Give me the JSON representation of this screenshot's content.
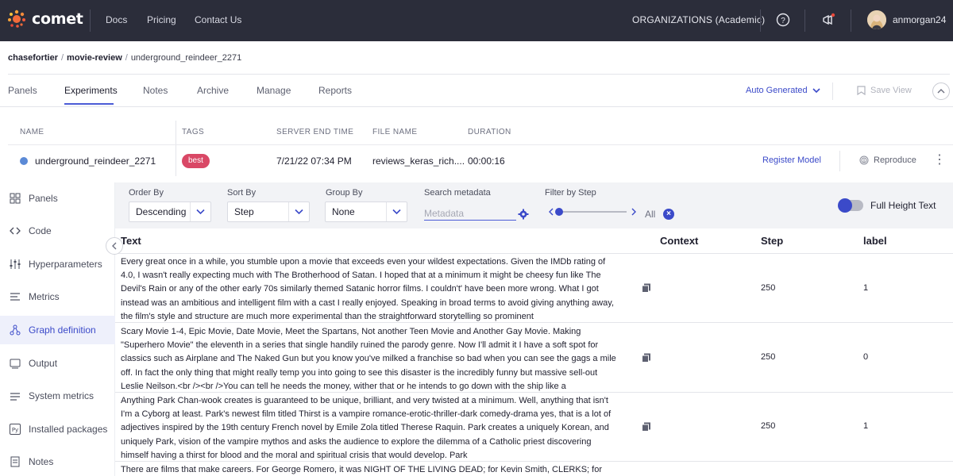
{
  "header": {
    "logo_text": "comet",
    "nav": [
      "Docs",
      "Pricing",
      "Contact Us"
    ],
    "organization": "ORGANIZATIONS (Academic)",
    "username": "anmorgan24"
  },
  "breadcrumb": {
    "workspace": "chasefortier",
    "project": "movie-review",
    "experiment": "underground_reindeer_2271",
    "separator": "/"
  },
  "tabs": [
    {
      "label": "Panels"
    },
    {
      "label": "Experiments"
    },
    {
      "label": "Notes"
    },
    {
      "label": "Archive"
    },
    {
      "label": "Manage"
    },
    {
      "label": "Reports"
    }
  ],
  "view": {
    "selector_label": "Auto Generated",
    "save_label": "Save View"
  },
  "experiment_table": {
    "columns": [
      "NAME",
      "TAGS",
      "SERVER END TIME",
      "FILE NAME",
      "DURATION"
    ],
    "row": {
      "name": "underground_reindeer_2271",
      "tag": "best",
      "server_end_time": "7/21/22 07:34 PM",
      "file_name": "reviews_keras_rich....",
      "duration": "00:00:16",
      "register_label": "Register Model",
      "reproduce_label": "Reproduce"
    }
  },
  "sidebar": {
    "items": [
      {
        "label": "Panels",
        "icon": "grid-icon"
      },
      {
        "label": "Code",
        "icon": "code-icon"
      },
      {
        "label": "Hyperparameters",
        "icon": "sliders-icon"
      },
      {
        "label": "Metrics",
        "icon": "list-icon"
      },
      {
        "label": "Graph definition",
        "icon": "graph-icon",
        "active": true
      },
      {
        "label": "Output",
        "icon": "terminal-icon"
      },
      {
        "label": "System metrics",
        "icon": "system-icon"
      },
      {
        "label": "Installed packages",
        "icon": "python-icon"
      },
      {
        "label": "Notes",
        "icon": "note-icon"
      }
    ]
  },
  "filters": {
    "order_by": {
      "label": "Order By",
      "value": "Descending"
    },
    "sort_by": {
      "label": "Sort By",
      "value": "Step"
    },
    "group_by": {
      "label": "Group By",
      "value": "None"
    },
    "search": {
      "label": "Search metadata",
      "placeholder": "Metadata"
    },
    "step": {
      "label": "Filter by Step",
      "value_label": "All"
    },
    "full_height": {
      "label": "Full Height Text",
      "enabled": true
    }
  },
  "text_table": {
    "columns": [
      "Text",
      "Context",
      "Step",
      "label"
    ],
    "rows": [
      {
        "text": "Every great once in a while, you stumble upon a movie that exceeds even your wildest expectations. Given the IMDb rating of 4.0, I wasn't really expecting much with The Brotherhood of Satan. I hoped that at a minimum it might be cheesy fun like The Devil's Rain or any of the other early 70s similarly themed Satanic horror films. I couldn't' have been more wrong. What I got instead was an ambitious and intelligent film with a cast I really enjoyed. Speaking in broad terms to avoid giving anything away, the film's style and structure are much more experimental than the straightforward storytelling so prominent",
        "step": "250",
        "label": "1"
      },
      {
        "text": "Scary Movie 1-4, Epic Movie, Date Movie, Meet the Spartans, Not another Teen Movie and Another Gay Movie. Making \"Superhero Movie\" the eleventh in a series that single handily ruined the parody genre. Now I'll admit it I have a soft spot for classics such as Airplane and The Naked Gun but you know you've milked a franchise so bad when you can see the gags a mile off. In fact the only thing that might really temp you into going to see this disaster is the incredibly funny but massive sell-out Leslie Neilson.<br /><br />You can tell he needs the money, wither that or he intends to go down with the ship like a",
        "step": "250",
        "label": "0"
      },
      {
        "text": "Anything Park Chan-wook creates is guaranteed to be unique, brilliant, and very twisted at a minimum. Well, anything that isn't I'm a Cyborg at least. Park's newest film titled Thirst is a vampire romance-erotic-thriller-dark comedy-drama      yes, that is a lot of adjectives      inspired by the 19th century French novel by Emile Zola titled Therese Raquin. Park creates a uniquely Korean, and uniquely Park, vision of the vampire mythos and asks the audience to explore the dilemma of a Catholic priest discovering himself having a thirst for blood and the moral and spiritual crisis that would develop. Park",
        "step": "250",
        "label": "1"
      },
      {
        "text": "There are films that make careers. For George Romero, it was NIGHT OF THE LIVING DEAD; for Kevin Smith, CLERKS; for",
        "step": "",
        "label": ""
      }
    ]
  },
  "colors": {
    "topbar": "#2b2d3a",
    "accent": "#3b4ac9",
    "tag_best": "#d94866",
    "status_dot": "#5b8ad6"
  }
}
